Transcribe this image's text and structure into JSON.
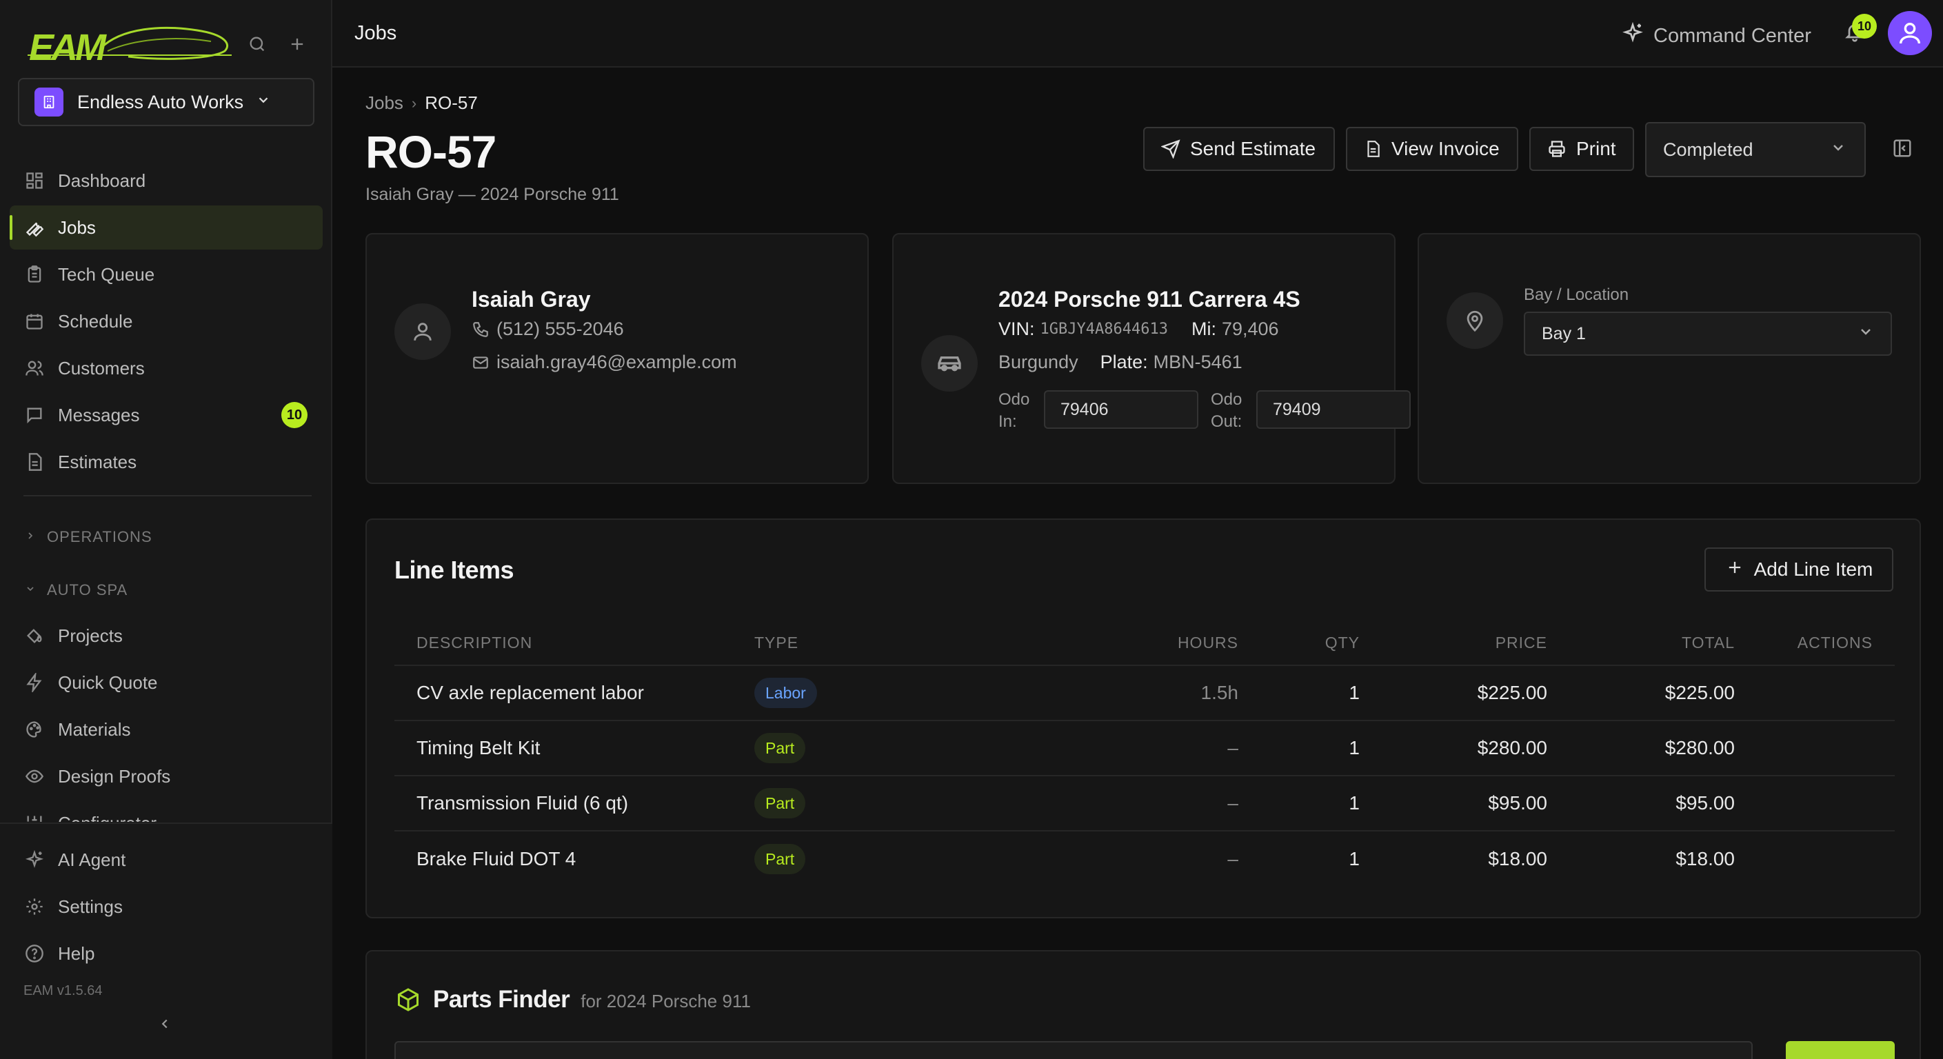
{
  "app": {
    "version": "EAM v1.5.64",
    "logo_text": "EAM"
  },
  "org": {
    "name": "Endless Auto Works"
  },
  "sidebar": {
    "items": [
      {
        "label": "Dashboard",
        "icon": "dashboard-icon"
      },
      {
        "label": "Jobs",
        "icon": "wrench-icon",
        "active": true
      },
      {
        "label": "Tech Queue",
        "icon": "clipboard-icon"
      },
      {
        "label": "Schedule",
        "icon": "calendar-icon"
      },
      {
        "label": "Customers",
        "icon": "users-icon"
      },
      {
        "label": "Messages",
        "icon": "message-icon",
        "badge": "10"
      },
      {
        "label": "Estimates",
        "icon": "file-icon"
      }
    ],
    "section_operations": "OPERATIONS",
    "section_auto_spa": "AUTO SPA",
    "auto_spa_items": [
      {
        "label": "Projects",
        "icon": "paint-bucket-icon"
      },
      {
        "label": "Quick Quote",
        "icon": "bolt-icon"
      },
      {
        "label": "Materials",
        "icon": "palette-icon"
      },
      {
        "label": "Design Proofs",
        "icon": "eye-icon"
      },
      {
        "label": "Configurator",
        "icon": "sliders-icon"
      }
    ],
    "bottom_items": [
      {
        "label": "AI Agent",
        "icon": "sparkles-icon"
      },
      {
        "label": "Settings",
        "icon": "gear-icon"
      },
      {
        "label": "Help",
        "icon": "help-icon"
      }
    ]
  },
  "topbar": {
    "title": "Jobs",
    "command_center": "Command Center",
    "notification_count": "10"
  },
  "breadcrumb": {
    "parent": "Jobs",
    "current": "RO-57"
  },
  "job": {
    "title": "RO-57",
    "subtitle": "Isaiah Gray — 2024 Porsche 911",
    "status": "Completed"
  },
  "actions": {
    "send_estimate": "Send Estimate",
    "view_invoice": "View Invoice",
    "print": "Print"
  },
  "customer": {
    "name": "Isaiah Gray",
    "phone": "(512) 555-2046",
    "email": "isaiah.gray46@example.com"
  },
  "vehicle": {
    "name": "2024 Porsche 911 Carrera 4S",
    "vin_label": "VIN:",
    "vin": "1GBJY4A8644613",
    "mi_label": "Mi:",
    "mileage": "79,406",
    "color": "Burgundy",
    "plate_label": "Plate:",
    "plate": "MBN-5461",
    "odo_in_label": "Odo In:",
    "odo_in": "79406",
    "odo_out_label": "Odo Out:",
    "odo_out": "79409"
  },
  "bay": {
    "label": "Bay / Location",
    "value": "Bay 1"
  },
  "line_items": {
    "title": "Line Items",
    "add_label": "Add Line Item",
    "columns": {
      "description": "DESCRIPTION",
      "type": "TYPE",
      "hours": "HOURS",
      "qty": "QTY",
      "price": "PRICE",
      "total": "TOTAL",
      "actions": "ACTIONS"
    },
    "rows": [
      {
        "description": "CV axle replacement labor",
        "type": "Labor",
        "hours": "1.5h",
        "qty": "1",
        "price": "$225.00",
        "total": "$225.00"
      },
      {
        "description": "Timing Belt Kit",
        "type": "Part",
        "hours": "–",
        "qty": "1",
        "price": "$280.00",
        "total": "$280.00"
      },
      {
        "description": "Transmission Fluid (6 qt)",
        "type": "Part",
        "hours": "–",
        "qty": "1",
        "price": "$95.00",
        "total": "$95.00"
      },
      {
        "description": "Brake Fluid DOT 4",
        "type": "Part",
        "hours": "–",
        "qty": "1",
        "price": "$18.00",
        "total": "$18.00"
      }
    ]
  },
  "parts_finder": {
    "title": "Parts Finder",
    "subtitle": "for 2024 Porsche 911"
  },
  "colors": {
    "accent": "#a6d92b",
    "badge": "#b8ec1f",
    "org": "#7c4dff",
    "labor": "#6aa4ff"
  }
}
